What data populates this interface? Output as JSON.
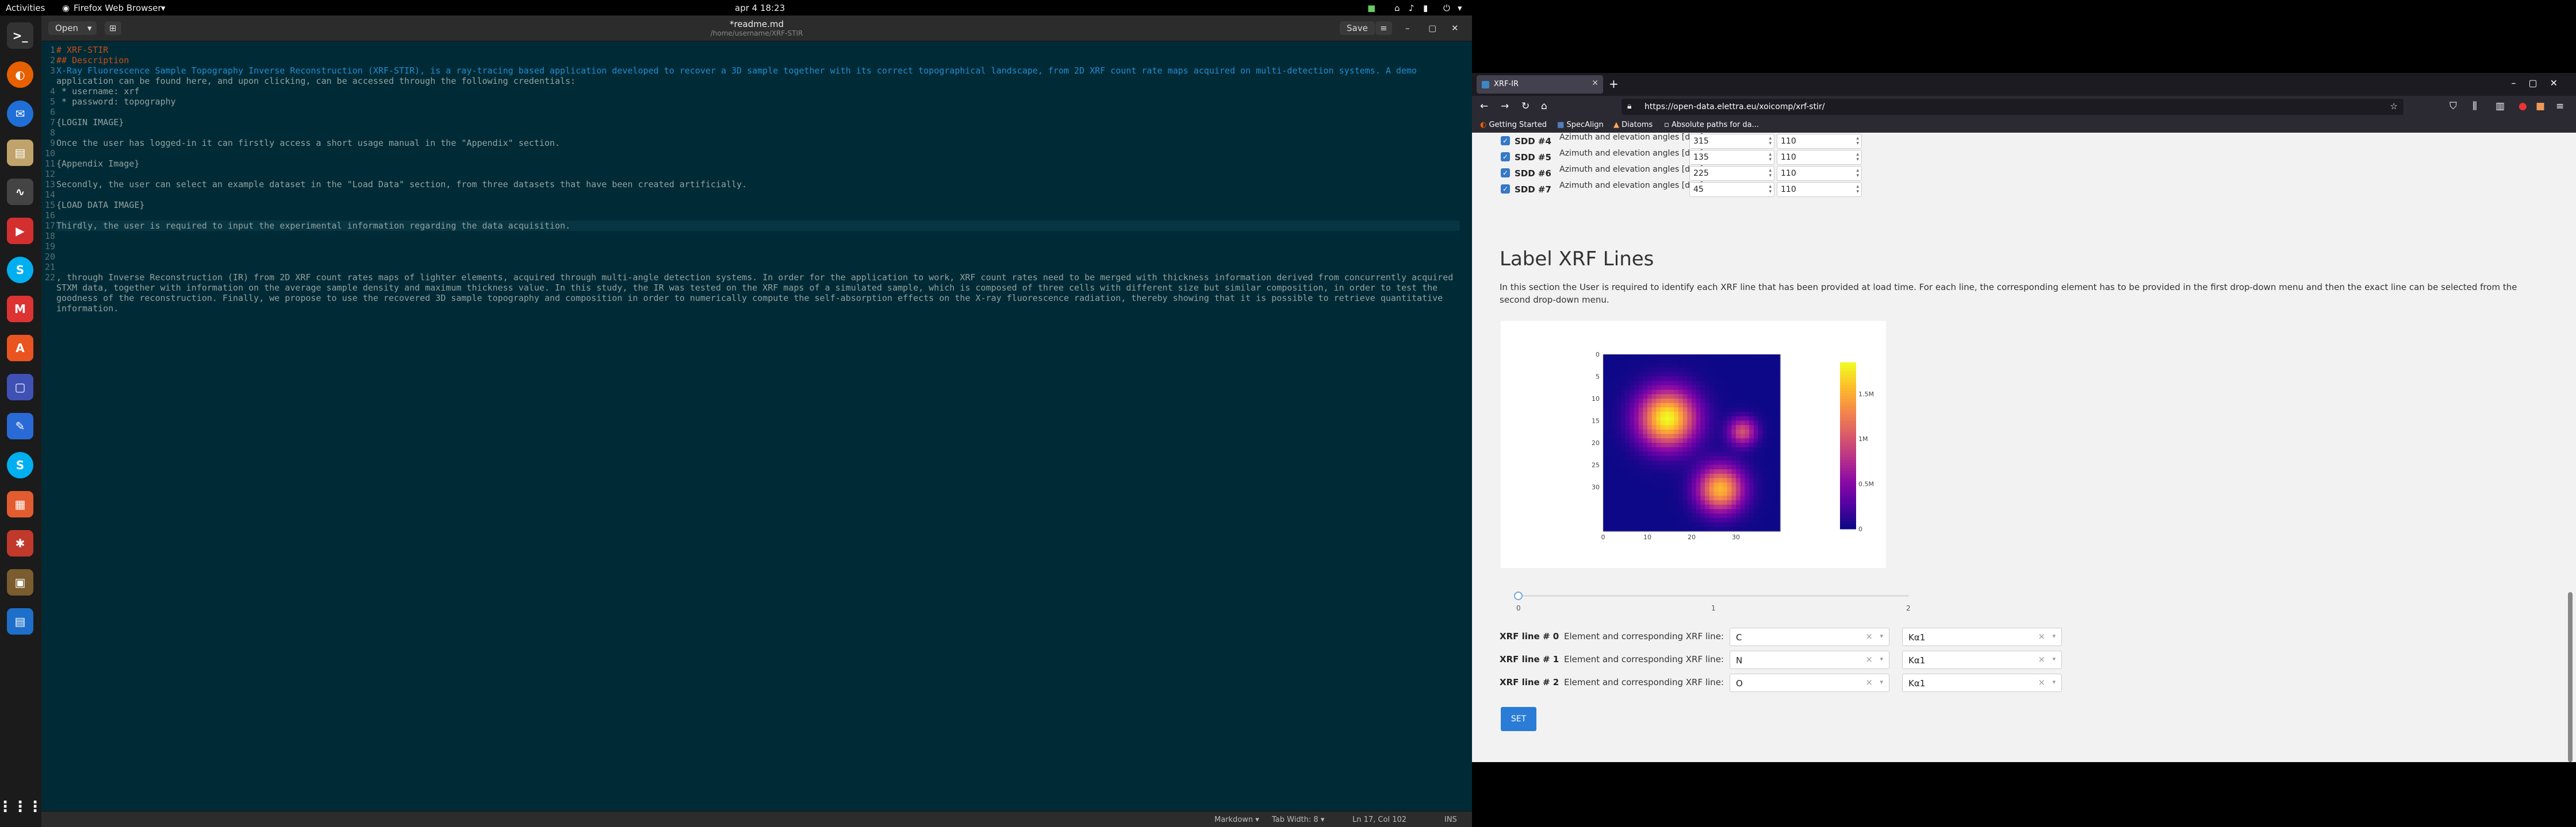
{
  "topbar": {
    "activities": "Activities",
    "app_name": "Firefox Web Browser",
    "clock": "apr 4  18:23"
  },
  "dock": {
    "icons": [
      "terminal-icon",
      "firefox-icon",
      "thunderbird-icon",
      "files-icon",
      "monitor-icon",
      "tabby-icon",
      "skype-icon",
      "app-icon",
      "software-icon",
      "screenshot-icon",
      "text-editor-icon",
      "skype-icon",
      "calendar-icon",
      "settings-icon",
      "image-viewer-icon",
      "document-viewer-icon",
      "apps-grid-icon"
    ]
  },
  "gedit": {
    "open_label": "Open",
    "save_label": "Save",
    "title": "*readme.md",
    "subtitle": "/home/username/XRF-STIR",
    "lines": [
      {
        "n": "1",
        "text": "# XRF-STIR",
        "cls": "heading"
      },
      {
        "n": "2",
        "text": "## Description",
        "cls": "heading"
      },
      {
        "n": "3",
        "text": "X-Ray Fluorescence Sample Topography Inverse Reconstruction (XRF-STIR), is a ray-tracing based application developed to recover a 3D sample together with its correct topographical landscape, from 2D XRF count rate maps acquired on multi-detection systems. A demo",
        "cls": "desc"
      },
      {
        "n": "",
        "text": "application can be found here, and upon clicking, can be accessed through the following credentials:",
        "cls": ""
      },
      {
        "n": "4",
        "text": " * username: xrf",
        "cls": ""
      },
      {
        "n": "5",
        "text": " * password: topography",
        "cls": ""
      },
      {
        "n": "6",
        "text": "",
        "cls": ""
      },
      {
        "n": "7",
        "text": "{LOGIN IMAGE}",
        "cls": ""
      },
      {
        "n": "8",
        "text": "",
        "cls": ""
      },
      {
        "n": "9",
        "text": "Once the user has logged-in it can firstly access a short usage manual in the \"Appendix\" section.",
        "cls": ""
      },
      {
        "n": "10",
        "text": "",
        "cls": ""
      },
      {
        "n": "11",
        "text": "{Appendix Image}",
        "cls": ""
      },
      {
        "n": "12",
        "text": "",
        "cls": ""
      },
      {
        "n": "13",
        "text": "Secondly, the user can select an example dataset in the \"Load Data\" section, from three datasets that have been created artificially.",
        "cls": ""
      },
      {
        "n": "14",
        "text": "",
        "cls": ""
      },
      {
        "n": "15",
        "text": "{LOAD DATA IMAGE}",
        "cls": ""
      },
      {
        "n": "16",
        "text": "",
        "cls": ""
      },
      {
        "n": "17",
        "text": "Thirdly, the user is required to input the experimental information regarding the data acquisition.",
        "cls": "cursor"
      },
      {
        "n": "18",
        "text": "",
        "cls": ""
      },
      {
        "n": "19",
        "text": "",
        "cls": ""
      },
      {
        "n": "20",
        "text": "",
        "cls": ""
      },
      {
        "n": "21",
        "text": "",
        "cls": ""
      },
      {
        "n": "22",
        "text": ", through Inverse Reconstruction (IR) from 2D XRF count rates maps of lighter elements, acquired through multi-angle detection systems. In order for the application to work, XRF count rates need to be merged with thickness information derived from concurrently acquired",
        "cls": ""
      },
      {
        "n": "",
        "text": "STXM data, together with information on the average sample density and maximum thickness value. In this study, the IR was tested on the XRF maps of a simulated sample, which is composed of three cells with different size but similar composition, in order to test the",
        "cls": ""
      },
      {
        "n": "",
        "text": "goodness of the reconstruction. Finally, we propose to use the recovered 3D sample topography and composition in order to numerically compute the self-absorption effects on the X-ray fluorescence radiation, thereby showing that it is possible to retrieve quantitative",
        "cls": ""
      },
      {
        "n": "",
        "text": "information.",
        "cls": ""
      }
    ],
    "status": {
      "language": "Markdown ▾",
      "tab_width": "Tab Width: 8 ▾",
      "position": "Ln 17, Col 102",
      "mode": "INS"
    }
  },
  "firefox": {
    "tab_title": "XRF-IR",
    "url": "https://open-data.elettra.eu/xoicomp/xrf-stir/",
    "bookmarks": [
      "Getting Started",
      "SpecAlign",
      "Diatoms",
      "Absolute paths for da..."
    ],
    "sdd_rows": [
      {
        "name": "SDD #4",
        "desc": "Azimuth and elevation angles [deg]:",
        "azimuth": "315",
        "elevation": "110"
      },
      {
        "name": "SDD #5",
        "desc": "Azimuth and elevation angles [deg]:",
        "azimuth": "135",
        "elevation": "110"
      },
      {
        "name": "SDD #6",
        "desc": "Azimuth and elevation angles [deg]:",
        "azimuth": "225",
        "elevation": "110"
      },
      {
        "name": "SDD #7",
        "desc": "Azimuth and elevation angles [deg]:",
        "azimuth": "45",
        "elevation": "110"
      }
    ],
    "section_title": "Label XRF Lines",
    "section_desc": "In this section the User is required to identify each XRF line that has been provided at load time. For each line, the corresponding element has to be provided in the first drop-down menu and then the exact line can be selected from the second drop-down menu.",
    "slider": {
      "value": 0,
      "ticks": [
        "0",
        "1",
        "2"
      ]
    },
    "xrf_rows": [
      {
        "name": "XRF line # 0",
        "desc": "Element and corresponding XRF line:",
        "element": "C",
        "line": "Kα1"
      },
      {
        "name": "XRF line # 1",
        "desc": "Element and corresponding XRF line:",
        "element": "N",
        "line": "Kα1"
      },
      {
        "name": "XRF line # 2",
        "desc": "Element and corresponding XRF line:",
        "element": "O",
        "line": "Kα1"
      }
    ],
    "set_label": "SET"
  },
  "chart_data": {
    "type": "heatmap",
    "x_ticks": [
      "0",
      "10",
      "20",
      "30"
    ],
    "y_ticks": [
      "0",
      "5",
      "10",
      "15",
      "20",
      "25",
      "30"
    ],
    "colorbar_ticks": [
      "0",
      "0.5M",
      "1M",
      "1.5M"
    ],
    "colorscale": "plasma",
    "blobs": [
      {
        "cx": 14,
        "cy": 14,
        "peak": 1.6,
        "sigma": 4.5
      },
      {
        "cx": 26,
        "cy": 30,
        "peak": 1.35,
        "sigma": 3.6
      },
      {
        "cx": 31,
        "cy": 17,
        "peak": 0.85,
        "sigma": 2.2
      }
    ]
  }
}
